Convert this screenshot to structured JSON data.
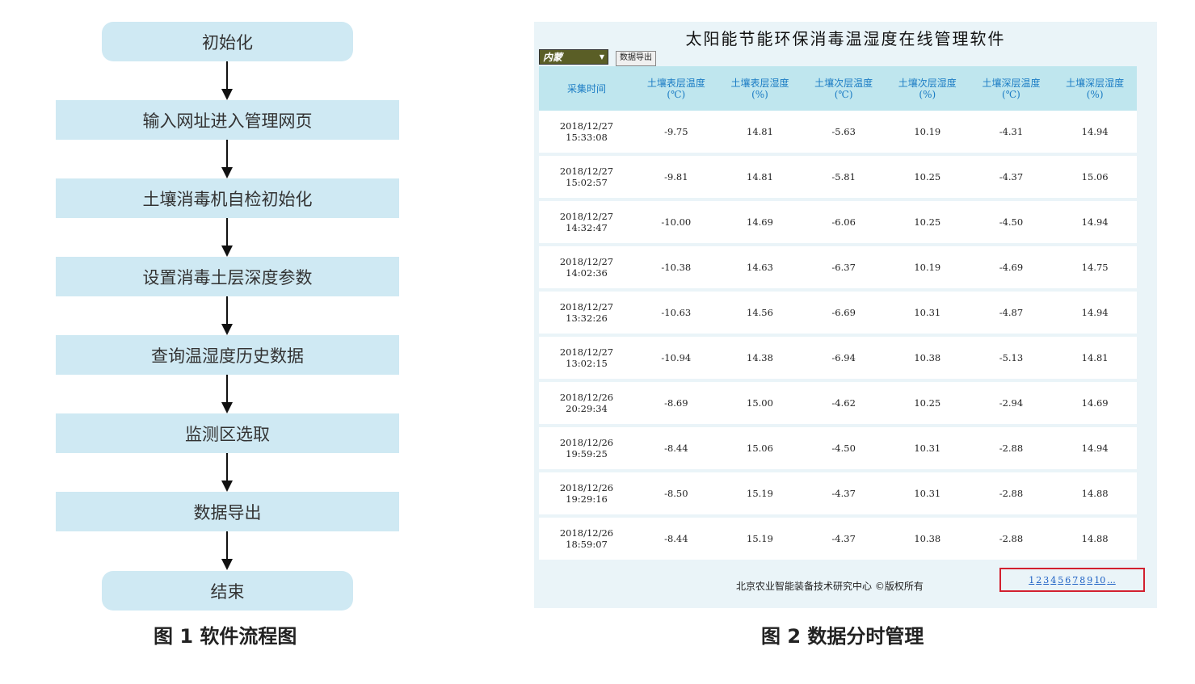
{
  "flowchart": {
    "steps": [
      "初始化",
      "输入网址进入管理网页",
      "土壤消毒机自检初始化",
      "设置消毒土层深度参数",
      "查询温湿度历史数据",
      "监测区选取",
      "数据导出",
      "结束"
    ],
    "caption": "图 1 软件流程图"
  },
  "panel": {
    "title": "太阳能节能环保消毒温湿度在线管理软件",
    "region_value": "内蒙",
    "export_label": "数据导出",
    "columns": [
      {
        "line1": "采集时间",
        "line2": ""
      },
      {
        "line1": "土壤表层温度",
        "line2": "(℃)"
      },
      {
        "line1": "土壤表层湿度",
        "line2": "(%)"
      },
      {
        "line1": "土壤次层温度",
        "line2": "(℃)"
      },
      {
        "line1": "土壤次层湿度",
        "line2": "(%)"
      },
      {
        "line1": "土壤深层温度",
        "line2": "(℃)"
      },
      {
        "line1": "土壤深层湿度",
        "line2": "(%)"
      }
    ],
    "rows": [
      [
        "2018/12/27",
        "15:33:08",
        "-9.75",
        "14.81",
        "-5.63",
        "10.19",
        "-4.31",
        "14.94"
      ],
      [
        "2018/12/27",
        "15:02:57",
        "-9.81",
        "14.81",
        "-5.81",
        "10.25",
        "-4.37",
        "15.06"
      ],
      [
        "2018/12/27",
        "14:32:47",
        "-10.00",
        "14.69",
        "-6.06",
        "10.25",
        "-4.50",
        "14.94"
      ],
      [
        "2018/12/27",
        "14:02:36",
        "-10.38",
        "14.63",
        "-6.37",
        "10.19",
        "-4.69",
        "14.75"
      ],
      [
        "2018/12/27",
        "13:32:26",
        "-10.63",
        "14.56",
        "-6.69",
        "10.31",
        "-4.87",
        "14.94"
      ],
      [
        "2018/12/27",
        "13:02:15",
        "-10.94",
        "14.38",
        "-6.94",
        "10.38",
        "-5.13",
        "14.81"
      ],
      [
        "2018/12/26",
        "20:29:34",
        "-8.69",
        "15.00",
        "-4.62",
        "10.25",
        "-2.94",
        "14.69"
      ],
      [
        "2018/12/26",
        "19:59:25",
        "-8.44",
        "15.06",
        "-4.50",
        "10.31",
        "-2.88",
        "14.94"
      ],
      [
        "2018/12/26",
        "19:29:16",
        "-8.50",
        "15.19",
        "-4.37",
        "10.31",
        "-2.88",
        "14.88"
      ],
      [
        "2018/12/26",
        "18:59:07",
        "-8.44",
        "15.19",
        "-4.37",
        "10.38",
        "-2.88",
        "14.88"
      ]
    ],
    "footer": "北京农业智能装备技术研究中心 ©版权所有",
    "pages": [
      "1",
      "2",
      "3",
      "4",
      "5",
      "6",
      "7",
      "8",
      "9",
      "10",
      "..."
    ],
    "caption": "图 2 数据分时管理"
  },
  "colors": {
    "node_fill": "#cfe9f3",
    "header_fill": "#bfe6ee",
    "header_text": "#1b7cc4",
    "highlight_border": "#d2202f",
    "link": "#1b5fc4"
  }
}
